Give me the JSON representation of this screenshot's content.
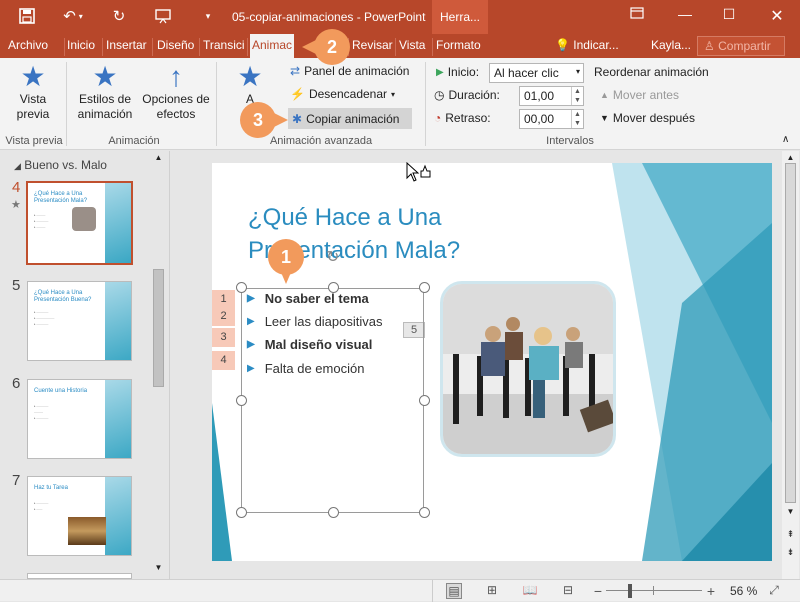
{
  "window": {
    "title": "05-copiar-animaciones - PowerPoint",
    "contextual_tab_group": "Herra...",
    "user": "Kayla...",
    "share_label": "Compartir",
    "tell_me_label": "Indicar..."
  },
  "tabs": [
    {
      "label": "Archivo",
      "active": false
    },
    {
      "label": "Inicio",
      "active": false
    },
    {
      "label": "Insertar",
      "active": false
    },
    {
      "label": "Diseño",
      "active": false
    },
    {
      "label": "Transici",
      "active": false
    },
    {
      "label": "Animac",
      "active": true
    },
    {
      "label": "Revisar",
      "active": false
    },
    {
      "label": "Vista",
      "active": false
    },
    {
      "label": "Formato",
      "active": false
    }
  ],
  "ribbon": {
    "preview": {
      "label_line1": "Vista",
      "label_line2": "previa",
      "group": "Vista previa"
    },
    "animation": {
      "styles_line1": "Estilos de",
      "styles_line2": "animación",
      "options_line1": "Opciones de",
      "options_line2": "efectos",
      "group": "Animación"
    },
    "advanced": {
      "add_line1": "A",
      "add_line2": "ani",
      "panel": "Panel de animación",
      "trigger": "Desencadenar",
      "copy": "Copiar animación",
      "group": "Animación avanzada"
    },
    "timing": {
      "start_label": "Inicio:",
      "start_value": "Al hacer clic",
      "duration_label": "Duración:",
      "duration_value": "01,00",
      "delay_label": "Retraso:",
      "delay_value": "00,00",
      "reorder": "Reordenar animación",
      "move_earlier": "Mover antes",
      "move_later": "Mover después",
      "group": "Intervalos"
    }
  },
  "slides_panel": {
    "section": "Bueno vs. Malo",
    "thumbs": [
      {
        "num": "4",
        "title": "¿Qué Hace a Una Presentación Mala?",
        "selected": true
      },
      {
        "num": "5",
        "title": "¿Qué Hace a Una Presentación Buena?",
        "selected": false
      },
      {
        "num": "6",
        "title": "Cuente una Historia",
        "selected": false
      },
      {
        "num": "7",
        "title": "Haz tu Tarea",
        "selected": false
      }
    ]
  },
  "slide": {
    "title": "¿Qué Hace a Una Presentación Mala?",
    "bullets": [
      {
        "text": "No saber el tema",
        "bold": true
      },
      {
        "text": "Leer las diapositivas",
        "bold": false
      },
      {
        "text": "Mal diseño visual",
        "bold": true
      },
      {
        "text": "Falta de emoción",
        "bold": false
      }
    ],
    "anim_tags": [
      "1",
      "2",
      "3",
      "4"
    ],
    "image_anim_tag": "5"
  },
  "callouts": [
    "1",
    "2",
    "3"
  ],
  "status": {
    "zoom": "56 %"
  },
  "colors": {
    "accent": "#b7472a",
    "callout": "#f29a5c",
    "title": "#2a8cbf",
    "anim_tag": "#f7c9b8"
  }
}
